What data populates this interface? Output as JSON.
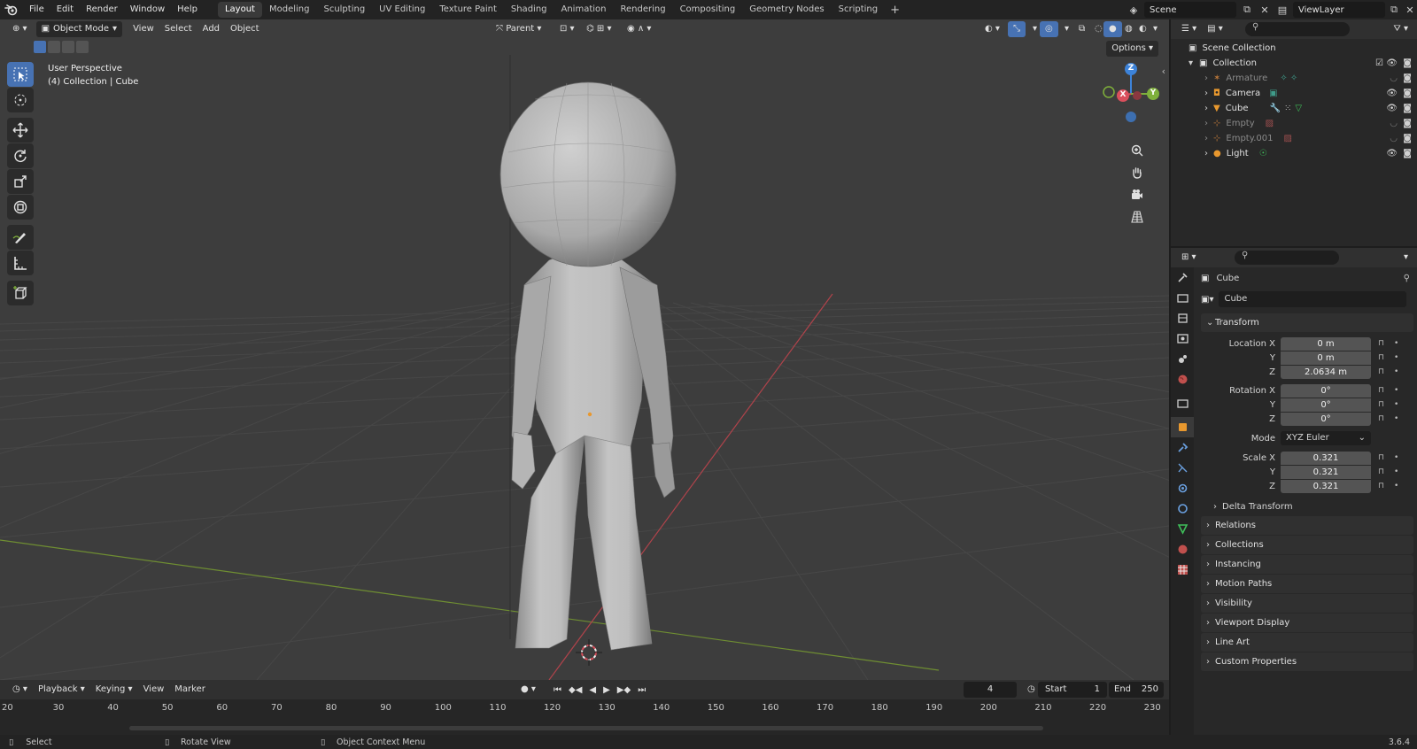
{
  "menu": [
    "File",
    "Edit",
    "Render",
    "Window",
    "Help"
  ],
  "workspaces": [
    "Layout",
    "Modeling",
    "Sculpting",
    "UV Editing",
    "Texture Paint",
    "Shading",
    "Animation",
    "Rendering",
    "Compositing",
    "Geometry Nodes",
    "Scripting"
  ],
  "active_workspace": "Layout",
  "add_tab": "+",
  "scene_name": "Scene",
  "view_layer": "ViewLayer",
  "viewport": {
    "mode": "Object Mode",
    "menus": [
      "View",
      "Select",
      "Add",
      "Object"
    ],
    "pivot": "Parent",
    "options": "Options",
    "info_line1": "User Perspective",
    "info_line2": "(4) Collection | Cube",
    "gizmo": {
      "x": "X",
      "y": "Y",
      "z": "Z"
    }
  },
  "outliner": {
    "root": "Scene Collection",
    "collection": "Collection",
    "items": [
      {
        "name": "Armature",
        "dim": true
      },
      {
        "name": "Camera",
        "dim": false
      },
      {
        "name": "Cube",
        "dim": false
      },
      {
        "name": "Empty",
        "dim": true
      },
      {
        "name": "Empty.001",
        "dim": true
      },
      {
        "name": "Light",
        "dim": false
      }
    ]
  },
  "properties": {
    "object_name": "Cube",
    "data_name": "Cube",
    "transform_title": "Transform",
    "location": {
      "label": "Location X",
      "x": "0 m",
      "y": "0 m",
      "z": "2.0634 m"
    },
    "rotation": {
      "label": "Rotation X",
      "x": "0°",
      "y": "0°",
      "z": "0°"
    },
    "axis_y": "Y",
    "axis_z": "Z",
    "mode_label": "Mode",
    "mode_value": "XYZ Euler",
    "scale": {
      "label": "Scale X",
      "x": "0.321",
      "y": "0.321",
      "z": "0.321"
    },
    "delta": "Delta Transform",
    "panels": [
      "Relations",
      "Collections",
      "Instancing",
      "Motion Paths",
      "Visibility",
      "Viewport Display",
      "Line Art",
      "Custom Properties"
    ]
  },
  "timeline": {
    "menus": [
      "Playback",
      "Keying",
      "View",
      "Marker"
    ],
    "current_frame": "4",
    "start_label": "Start",
    "start": "1",
    "end_label": "End",
    "end": "250",
    "ticks": [
      "20",
      "30",
      "40",
      "50",
      "60",
      "70",
      "80",
      "90",
      "100",
      "110",
      "120",
      "130",
      "140",
      "150",
      "160",
      "170",
      "180",
      "190",
      "200",
      "210",
      "220",
      "230"
    ]
  },
  "status": {
    "select": "Select",
    "rotate": "Rotate View",
    "context": "Object Context Menu",
    "version": "3.6.4"
  },
  "colors": {
    "accent": "#4772b3",
    "x_axis": "#d94f5c",
    "y_axis": "#7fb03b",
    "z_axis": "#3d83d9",
    "active_object": "#e8982e"
  }
}
